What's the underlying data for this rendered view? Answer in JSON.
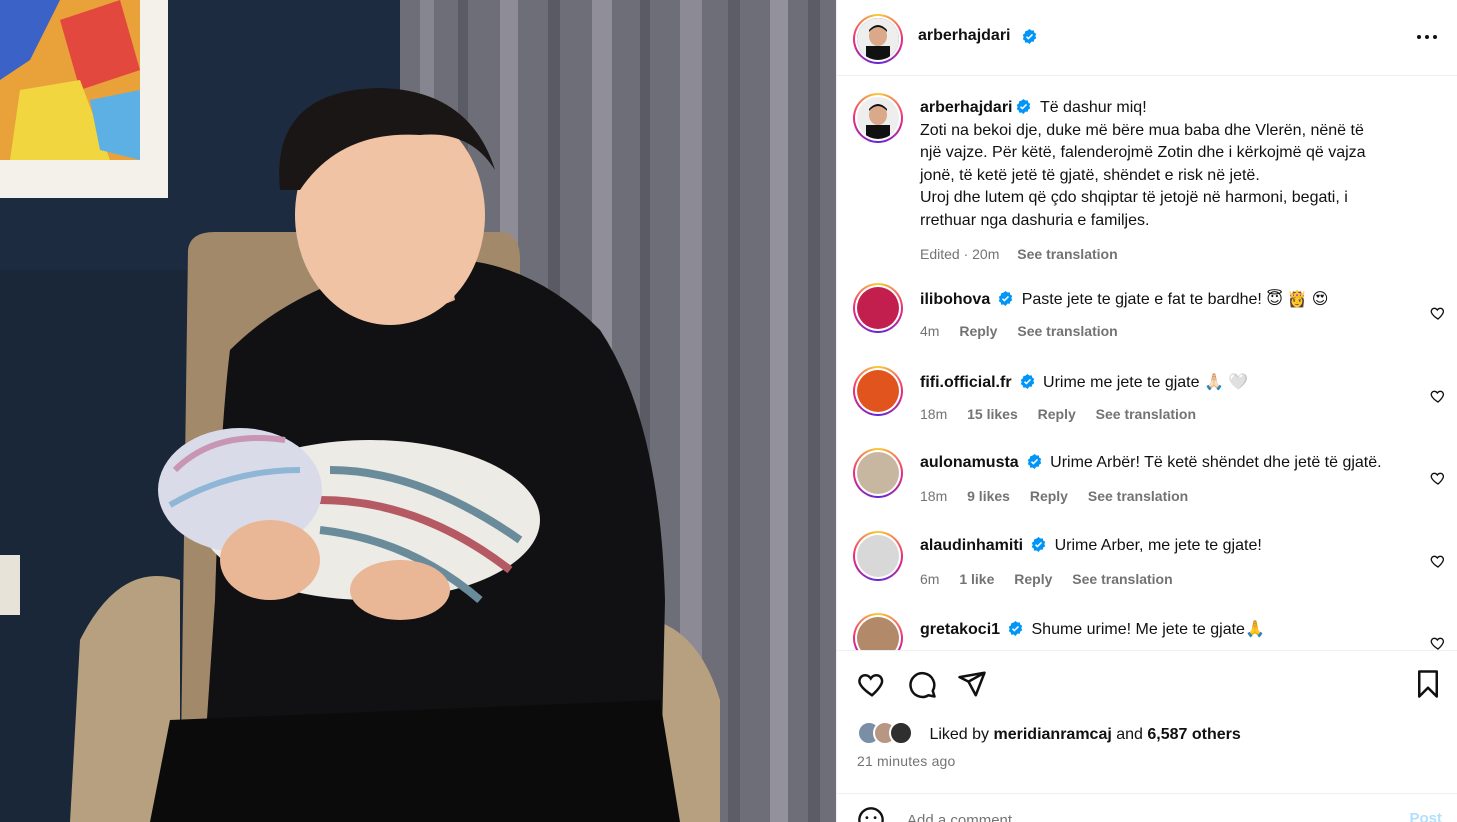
{
  "post": {
    "author": "arberhajdari",
    "caption_author": "arberhajdari",
    "caption_lines": [
      "Të dashur miq!",
      "Zoti na bekoi dje, duke më bëre mua baba dhe Vlerën, nënë të",
      "një vajze. Për këtë, falenderojmë Zotin dhe i kërkojmë që vajza",
      "jonë, të ketë jetë të gjatë, shëndet e risk në jetë.",
      "Uroj dhe lutem që çdo shqiptar të jetojë në harmoni, begati, i",
      "rrethuar nga dashuria e familjes."
    ],
    "edited_label": "Edited · 20m",
    "see_translation": "See translation"
  },
  "comments": [
    {
      "user": "ilibohova",
      "text": "Paste jete te gjate e fat te bardhe! 😇 👸 😍",
      "time": "4m",
      "likes": "",
      "reply": "Reply",
      "translate": "See translation"
    },
    {
      "user": "fifi.official.fr",
      "text": "Urime me jete te gjate 🙏🏻 🤍",
      "time": "18m",
      "likes": "15 likes",
      "reply": "Reply",
      "translate": "See translation"
    },
    {
      "user": "aulonamusta",
      "text": "Urime Arbër! Të ketë shëndet dhe jetë të gjatë.",
      "time": "18m",
      "likes": "9 likes",
      "reply": "Reply",
      "translate": "See translation"
    },
    {
      "user": "alaudinhamiti",
      "text": "Urime Arber, me jete te gjate!",
      "time": "6m",
      "likes": "1 like",
      "reply": "Reply",
      "translate": "See translation"
    },
    {
      "user": "gretakoci1",
      "text": "Shume urime! Me jete te gjate🙏",
      "time": "",
      "likes": "",
      "reply": "",
      "translate": ""
    }
  ],
  "likes": {
    "prefix": "Liked by",
    "first_user": "meridianramcaj",
    "conj": "and",
    "others": "6,587 others"
  },
  "time_ago": "21 minutes ago",
  "add_comment": {
    "placeholder": "Add a comment…",
    "post_label": "Post"
  },
  "colors": {
    "verified": "#0095f6",
    "muted": "#737373",
    "post_disabled": "#b2dffc"
  },
  "icons": [
    "heart-icon",
    "comment-icon",
    "share-icon",
    "bookmark-icon",
    "more-icon",
    "verified-icon",
    "emoji-icon"
  ]
}
